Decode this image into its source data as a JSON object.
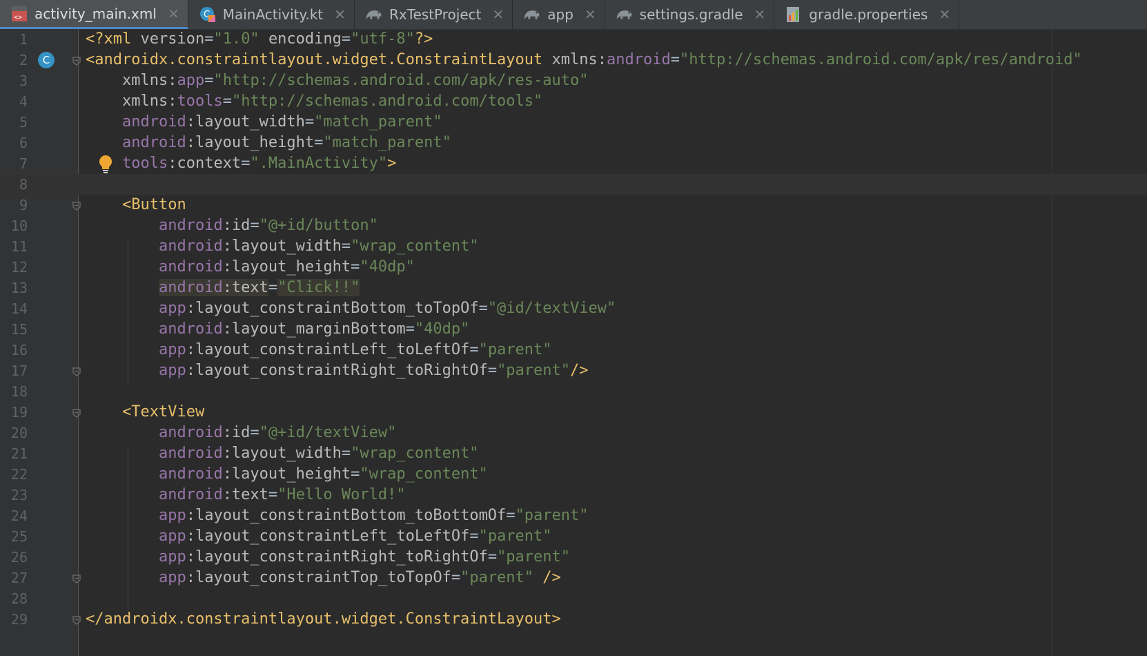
{
  "tabs": [
    {
      "label": "activity_main.xml",
      "icon": "xml-layout-icon",
      "active": true
    },
    {
      "label": "MainActivity.kt",
      "icon": "kotlin-class-icon",
      "active": false
    },
    {
      "label": "RxTestProject",
      "icon": "gradle-elephant-icon",
      "active": false
    },
    {
      "label": "app",
      "icon": "gradle-elephant-icon",
      "active": false
    },
    {
      "label": "settings.gradle",
      "icon": "gradle-elephant-icon",
      "active": false
    },
    {
      "label": "gradle.properties",
      "icon": "properties-file-icon",
      "active": false
    }
  ],
  "editor": {
    "current_line": 8,
    "highlighted_line": 13,
    "lines": [
      {
        "n": "1",
        "tokens": [
          [
            "tag",
            "<?xml "
          ],
          [
            "attr",
            "version"
          ],
          [
            "plain",
            "="
          ],
          [
            "str",
            "\"1.0\""
          ],
          [
            "plain",
            " "
          ],
          [
            "attr",
            "encoding"
          ],
          [
            "plain",
            "="
          ],
          [
            "str",
            "\"utf-8\""
          ],
          [
            "tag",
            "?>"
          ]
        ]
      },
      {
        "n": "2",
        "tokens": [
          [
            "tag",
            "<androidx.constraintlayout.widget.ConstraintLayout "
          ],
          [
            "attr",
            "xmlns:"
          ],
          [
            "ns",
            "android"
          ],
          [
            "plain",
            "="
          ],
          [
            "str",
            "\"http://schemas.android.com/apk/res/android\""
          ]
        ]
      },
      {
        "n": "3",
        "tokens": [
          [
            "plain",
            "    "
          ],
          [
            "attr",
            "xmlns:"
          ],
          [
            "ns",
            "app"
          ],
          [
            "plain",
            "="
          ],
          [
            "str",
            "\"http://schemas.android.com/apk/res-auto\""
          ]
        ]
      },
      {
        "n": "4",
        "tokens": [
          [
            "plain",
            "    "
          ],
          [
            "attr",
            "xmlns:"
          ],
          [
            "ns",
            "tools"
          ],
          [
            "plain",
            "="
          ],
          [
            "str",
            "\"http://schemas.android.com/tools\""
          ]
        ]
      },
      {
        "n": "5",
        "tokens": [
          [
            "plain",
            "    "
          ],
          [
            "ns",
            "android"
          ],
          [
            "attr",
            ":layout_width"
          ],
          [
            "plain",
            "="
          ],
          [
            "str",
            "\"match_parent\""
          ]
        ]
      },
      {
        "n": "6",
        "tokens": [
          [
            "plain",
            "    "
          ],
          [
            "ns",
            "android"
          ],
          [
            "attr",
            ":layout_height"
          ],
          [
            "plain",
            "="
          ],
          [
            "str",
            "\"match_parent\""
          ]
        ]
      },
      {
        "n": "7",
        "tokens": [
          [
            "plain",
            "    "
          ],
          [
            "ns",
            "tools"
          ],
          [
            "attr",
            ":context"
          ],
          [
            "plain",
            "="
          ],
          [
            "str",
            "\".MainActivity\""
          ],
          [
            "tag",
            ">"
          ]
        ]
      },
      {
        "n": "8",
        "tokens": []
      },
      {
        "n": "9",
        "tokens": [
          [
            "plain",
            "    "
          ],
          [
            "tag",
            "<Button"
          ]
        ]
      },
      {
        "n": "10",
        "tokens": [
          [
            "plain",
            "        "
          ],
          [
            "ns",
            "android"
          ],
          [
            "attr",
            ":id"
          ],
          [
            "plain",
            "="
          ],
          [
            "str",
            "\"@+id/button\""
          ]
        ]
      },
      {
        "n": "11",
        "tokens": [
          [
            "plain",
            "        "
          ],
          [
            "ns",
            "android"
          ],
          [
            "attr",
            ":layout_width"
          ],
          [
            "plain",
            "="
          ],
          [
            "str",
            "\"wrap_content\""
          ]
        ]
      },
      {
        "n": "12",
        "tokens": [
          [
            "plain",
            "        "
          ],
          [
            "ns",
            "android"
          ],
          [
            "attr",
            ":layout_height"
          ],
          [
            "plain",
            "="
          ],
          [
            "str",
            "\"40dp\""
          ]
        ]
      },
      {
        "n": "13",
        "tokens": [
          [
            "plain",
            "        "
          ],
          [
            "ns",
            "android"
          ],
          [
            "attr",
            ":text"
          ],
          [
            "plain",
            "="
          ],
          [
            "str",
            "\"Click!!\""
          ]
        ]
      },
      {
        "n": "14",
        "tokens": [
          [
            "plain",
            "        "
          ],
          [
            "ns",
            "app"
          ],
          [
            "attr",
            ":layout_constraintBottom_toTopOf"
          ],
          [
            "plain",
            "="
          ],
          [
            "str",
            "\"@id/textView\""
          ]
        ]
      },
      {
        "n": "15",
        "tokens": [
          [
            "plain",
            "        "
          ],
          [
            "ns",
            "android"
          ],
          [
            "attr",
            ":layout_marginBottom"
          ],
          [
            "plain",
            "="
          ],
          [
            "str",
            "\"40dp\""
          ]
        ]
      },
      {
        "n": "16",
        "tokens": [
          [
            "plain",
            "        "
          ],
          [
            "ns",
            "app"
          ],
          [
            "attr",
            ":layout_constraintLeft_toLeftOf"
          ],
          [
            "plain",
            "="
          ],
          [
            "str",
            "\"parent\""
          ]
        ]
      },
      {
        "n": "17",
        "tokens": [
          [
            "plain",
            "        "
          ],
          [
            "ns",
            "app"
          ],
          [
            "attr",
            ":layout_constraintRight_toRightOf"
          ],
          [
            "plain",
            "="
          ],
          [
            "str",
            "\"parent\""
          ],
          [
            "tag",
            "/>"
          ]
        ]
      },
      {
        "n": "18",
        "tokens": []
      },
      {
        "n": "19",
        "tokens": [
          [
            "plain",
            "    "
          ],
          [
            "tag",
            "<TextView"
          ]
        ]
      },
      {
        "n": "20",
        "tokens": [
          [
            "plain",
            "        "
          ],
          [
            "ns",
            "android"
          ],
          [
            "attr",
            ":id"
          ],
          [
            "plain",
            "="
          ],
          [
            "str",
            "\"@+id/textView\""
          ]
        ]
      },
      {
        "n": "21",
        "tokens": [
          [
            "plain",
            "        "
          ],
          [
            "ns",
            "android"
          ],
          [
            "attr",
            ":layout_width"
          ],
          [
            "plain",
            "="
          ],
          [
            "str",
            "\"wrap_content\""
          ]
        ]
      },
      {
        "n": "22",
        "tokens": [
          [
            "plain",
            "        "
          ],
          [
            "ns",
            "android"
          ],
          [
            "attr",
            ":layout_height"
          ],
          [
            "plain",
            "="
          ],
          [
            "str",
            "\"wrap_content\""
          ]
        ]
      },
      {
        "n": "23",
        "tokens": [
          [
            "plain",
            "        "
          ],
          [
            "ns",
            "android"
          ],
          [
            "attr",
            ":text"
          ],
          [
            "plain",
            "="
          ],
          [
            "str",
            "\"Hello World!\""
          ]
        ]
      },
      {
        "n": "24",
        "tokens": [
          [
            "plain",
            "        "
          ],
          [
            "ns",
            "app"
          ],
          [
            "attr",
            ":layout_constraintBottom_toBottomOf"
          ],
          [
            "plain",
            "="
          ],
          [
            "str",
            "\"parent\""
          ]
        ]
      },
      {
        "n": "25",
        "tokens": [
          [
            "plain",
            "        "
          ],
          [
            "ns",
            "app"
          ],
          [
            "attr",
            ":layout_constraintLeft_toLeftOf"
          ],
          [
            "plain",
            "="
          ],
          [
            "str",
            "\"parent\""
          ]
        ]
      },
      {
        "n": "26",
        "tokens": [
          [
            "plain",
            "        "
          ],
          [
            "ns",
            "app"
          ],
          [
            "attr",
            ":layout_constraintRight_toRightOf"
          ],
          [
            "plain",
            "="
          ],
          [
            "str",
            "\"parent\""
          ]
        ]
      },
      {
        "n": "27",
        "tokens": [
          [
            "plain",
            "        "
          ],
          [
            "ns",
            "app"
          ],
          [
            "attr",
            ":layout_constraintTop_toTopOf"
          ],
          [
            "plain",
            "="
          ],
          [
            "str",
            "\"parent\""
          ],
          [
            "plain",
            " "
          ],
          [
            "tag",
            "/>"
          ]
        ]
      },
      {
        "n": "28",
        "tokens": []
      },
      {
        "n": "29",
        "tokens": [
          [
            "tag",
            "</androidx.constraintlayout.widget.ConstraintLayout>"
          ]
        ]
      }
    ]
  },
  "gutter_icons": {
    "class_marker": {
      "line": 2,
      "label": "C",
      "color": "#3592c4"
    },
    "intention_bulb": {
      "line": 7,
      "color": "#f0a732"
    }
  },
  "fold_markers": [
    2,
    9,
    17,
    19,
    27,
    29
  ],
  "colors": {
    "background": "#2b2b2b",
    "gutter": "#313335",
    "tag": "#e8bf6a",
    "namespace": "#9876aa",
    "attribute": "#bababa",
    "string": "#6a8759"
  }
}
